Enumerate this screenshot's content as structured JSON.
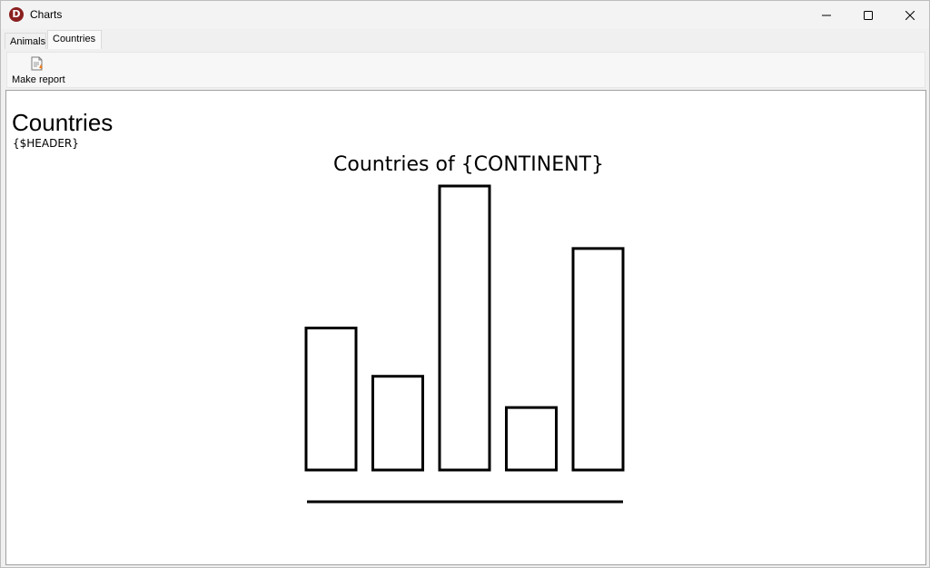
{
  "window": {
    "title": "Charts",
    "app_icon_letter": "D"
  },
  "tabs": [
    {
      "label": "Animals",
      "selected": false
    },
    {
      "label": "Countries",
      "selected": true
    }
  ],
  "toolbar": {
    "make_report_label": "Make report"
  },
  "report": {
    "title": "Countries",
    "header": "{$HEADER}"
  },
  "chart_data": {
    "type": "bar",
    "title": "Countries of {CONTINENT}",
    "xlabel": "",
    "ylabel": "",
    "values": [
      0.5,
      0.33,
      1.0,
      0.22,
      0.78
    ],
    "ylim": [
      0,
      1
    ],
    "grid": false,
    "legend": "none"
  },
  "colors": {
    "app_icon": "#8a1f1f",
    "bar_stroke": "#000000",
    "background": "#ffffff"
  }
}
